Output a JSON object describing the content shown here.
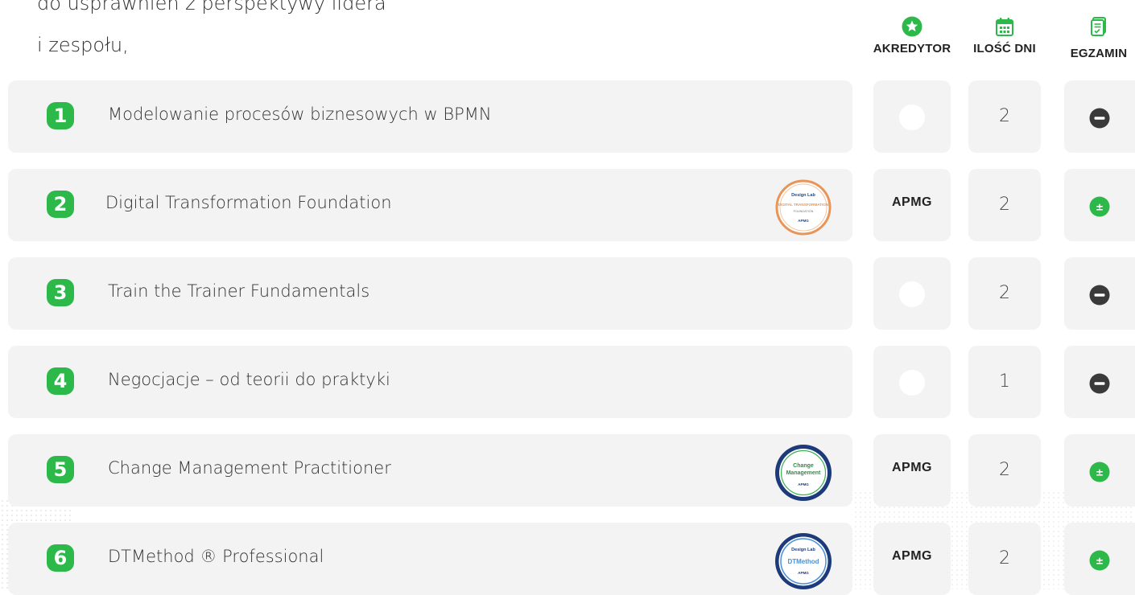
{
  "intro": {
    "line1": "do usprawnień z perspektywy lidera",
    "line2": "i zespołu,"
  },
  "headers": {
    "accreditor": "AKREDYTOR",
    "days": "ILOŚĆ DNI",
    "exam": "EGZAMIN"
  },
  "colors": {
    "accent_green": "#2db84a",
    "card_bg": "#f3f3f3",
    "minus_icon": "#3a3a3a"
  },
  "courses": [
    {
      "number": "1",
      "title": "Modelowanie procesów biznesowych w BPMN",
      "accreditor": "",
      "days": "2",
      "exam": "minus-icon",
      "badge": ""
    },
    {
      "number": "2",
      "title": "Digital Transformation Foundation",
      "accreditor": "APMG",
      "days": "2",
      "exam": "plus-minus-icon",
      "badge": "digital-transformation-badge"
    },
    {
      "number": "3",
      "title": "Train the Trainer Fundamentals",
      "accreditor": "",
      "days": "2",
      "exam": "minus-icon",
      "badge": ""
    },
    {
      "number": "4",
      "title": "Negocjacje – od teorii do praktyki",
      "accreditor": "",
      "days": "1",
      "exam": "minus-icon",
      "badge": ""
    },
    {
      "number": "5",
      "title": "Change Management Practitioner",
      "accreditor": "APMG",
      "days": "2",
      "exam": "plus-minus-icon",
      "badge": "change-management-badge"
    },
    {
      "number": "6",
      "title": "DTMethod ® Professional",
      "accreditor": "APMG",
      "days": "2",
      "exam": "plus-minus-icon",
      "badge": "dtmethod-badge"
    }
  ],
  "badges": {
    "dt_foundation": {
      "brand": "Design Lab",
      "name": "DIGITAL TRANSFORMATION",
      "level": "FOUNDATION",
      "org": "APMG"
    },
    "change_mgmt": {
      "name_line1": "Change",
      "name_line2": "Management",
      "org": "APMG"
    },
    "dtmethod": {
      "brand": "Design Lab",
      "name": "DTMethod",
      "org": "APMG"
    }
  }
}
